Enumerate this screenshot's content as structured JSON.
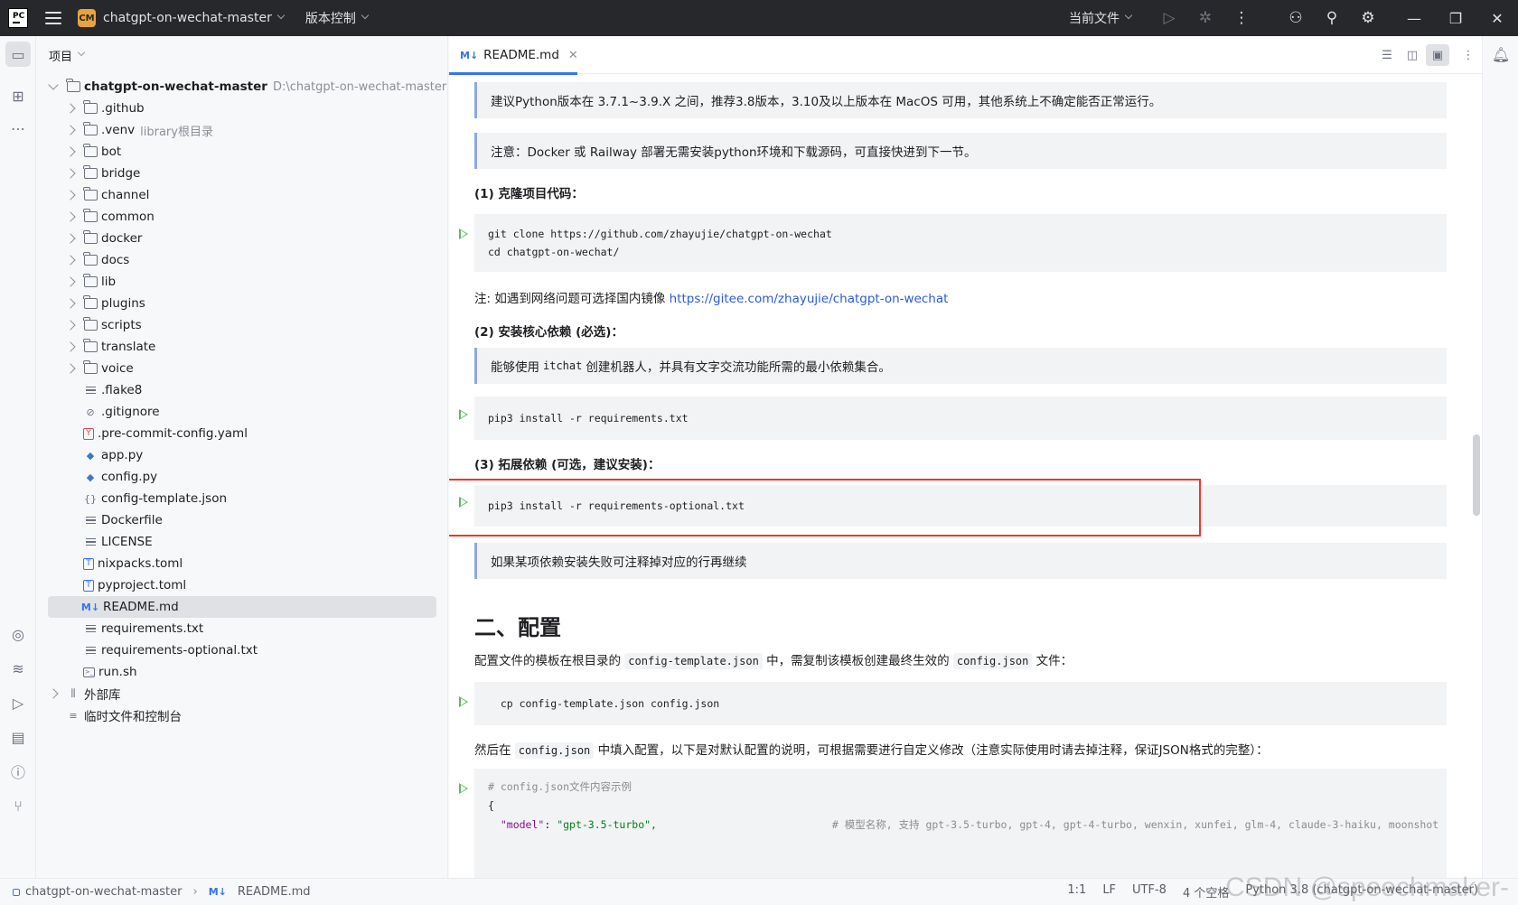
{
  "titlebar": {
    "app_logo": "PC",
    "project_badge": "CM",
    "project_name": "chatgpt-on-wechat-master",
    "vcs_label": "版本控制",
    "run_config": "当前文件"
  },
  "project_panel": {
    "title": "项目",
    "root": {
      "name": "chatgpt-on-wechat-master",
      "path": "D:\\chatgpt-on-wechat-master"
    },
    "items": [
      {
        "label": ".github",
        "hint": ""
      },
      {
        "label": ".venv",
        "hint": "library根目录"
      },
      {
        "label": "bot",
        "hint": ""
      },
      {
        "label": "bridge",
        "hint": ""
      },
      {
        "label": "channel",
        "hint": ""
      },
      {
        "label": "common",
        "hint": ""
      },
      {
        "label": "docker",
        "hint": ""
      },
      {
        "label": "docs",
        "hint": ""
      },
      {
        "label": "lib",
        "hint": ""
      },
      {
        "label": "plugins",
        "hint": ""
      },
      {
        "label": "scripts",
        "hint": ""
      },
      {
        "label": "translate",
        "hint": ""
      },
      {
        "label": "voice",
        "hint": ""
      },
      {
        "label": ".flake8",
        "hint": ""
      },
      {
        "label": ".gitignore",
        "hint": ""
      },
      {
        "label": ".pre-commit-config.yaml",
        "hint": ""
      },
      {
        "label": "app.py",
        "hint": ""
      },
      {
        "label": "config.py",
        "hint": ""
      },
      {
        "label": "config-template.json",
        "hint": ""
      },
      {
        "label": "Dockerfile",
        "hint": ""
      },
      {
        "label": "LICENSE",
        "hint": ""
      },
      {
        "label": "nixpacks.toml",
        "hint": ""
      },
      {
        "label": "pyproject.toml",
        "hint": ""
      },
      {
        "label": "README.md",
        "hint": ""
      },
      {
        "label": "requirements.txt",
        "hint": ""
      },
      {
        "label": "requirements-optional.txt",
        "hint": ""
      },
      {
        "label": "run.sh",
        "hint": ""
      }
    ],
    "external_libs": "外部库",
    "scratches": "临时文件和控制台"
  },
  "editor": {
    "tab_label": "README.md",
    "tab_icon": "M↓",
    "content": {
      "q1": "建议Python版本在 3.7.1~3.9.X 之间，推荐3.8版本，3.10及以上版本在 MacOS 可用，其他系统上不确定能否正常运行。",
      "q2": "注意：Docker 或 Railway 部署无需安装python环境和下载源码，可直接快进到下一节。",
      "h_clone": "(1) 克隆项目代码：",
      "code1_l1": "git clone https://github.com/zhayujie/chatgpt-on-wechat",
      "code1_l2": "cd chatgpt-on-wechat/",
      "note_prefix": "注: 如遇到网络问题可选择国内镜像 ",
      "note_link": "https://gitee.com/zhayujie/chatgpt-on-wechat",
      "h_install": "(2) 安装核心依赖 (必选)：",
      "q3_pre": "能够使用 ",
      "q3_code": "itchat",
      "q3_post": " 创建机器人，并具有文字交流功能所需的最小依赖集合。",
      "code2": "pip3 install -r requirements.txt",
      "h_ext": "(3) 拓展依赖 (可选，建议安装)：",
      "code3": "pip3 install -r requirements-optional.txt",
      "q4": "如果某项依赖安装失败可注释掉对应的行再继续",
      "h2": "二、配置",
      "p_cfg_1": "配置文件的模板在根目录的 ",
      "p_cfg_code1": "config-template.json",
      "p_cfg_2": " 中，需复制该模板创建最终生效的 ",
      "p_cfg_code2": "config.json",
      "p_cfg_3": " 文件：",
      "code4": "  cp config-template.json config.json",
      "p_then_1": "然后在 ",
      "p_then_code": "config.json",
      "p_then_2": " 中填入配置，以下是对默认配置的说明，可根据需要进行自定义修改（注意实际使用时请去掉注释，保证JSON格式的完整）：",
      "code5_comment": "# config.json文件内容示例",
      "code5_brace": "{",
      "code5_key": "\"model\"",
      "code5_val": "\"gpt-3.5-turbo\",",
      "code5_tail": "# 模型名称, 支持 gpt-3.5-turbo, gpt-4, gpt-4-turbo, wenxin, xunfei, glm-4, claude-3-haiku, moonshot"
    }
  },
  "statusbar": {
    "breadcrumb_root": "chatgpt-on-wechat-master",
    "breadcrumb_file": "README.md",
    "position": "1:1",
    "line_sep": "LF",
    "encoding": "UTF-8",
    "indent": "4 个空格",
    "interpreter": "Python 3.8 (chatgpt-on-wechat-master)",
    "watermark": "CSDN @speechmaker-"
  },
  "colors": {
    "accent": "#3574f0",
    "highlight_box": "#e53935",
    "run_gutter": "#5fb865",
    "titlebar_bg": "#27282c"
  }
}
